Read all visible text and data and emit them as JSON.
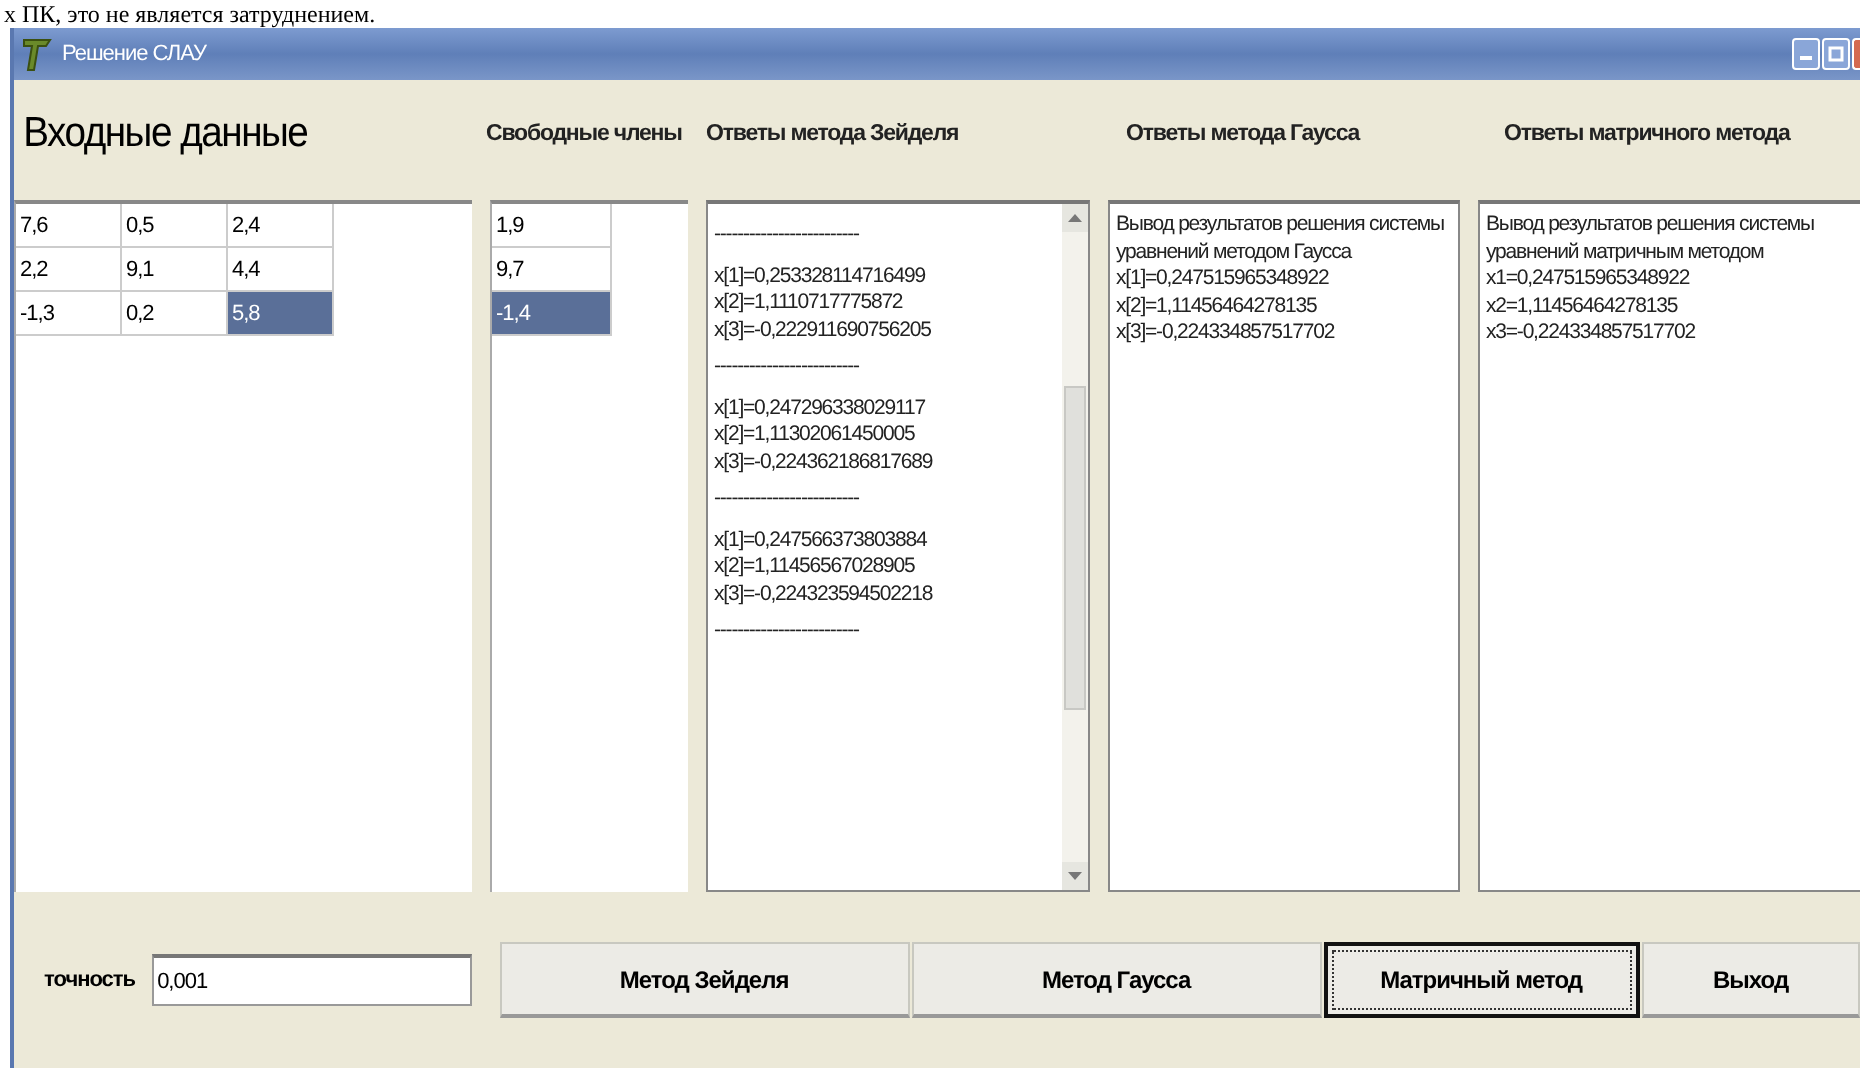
{
  "document_text": "х ПК, это не является затруднением.",
  "window": {
    "title": "Решение СЛАУ"
  },
  "input_heading": "Входные данные",
  "headers": [
    "Свободные члены",
    "Ответы метода Зейделя",
    "Ответы метода Гаусса",
    "Ответы матричного метода"
  ],
  "matrix_grid": {
    "rows": [
      [
        {
          "text": "7,6",
          "selected": false
        },
        {
          "text": "0,5",
          "selected": false
        },
        {
          "text": "2,4",
          "selected": false
        }
      ],
      [
        {
          "text": "2,2",
          "selected": false
        },
        {
          "text": "9,1",
          "selected": false
        },
        {
          "text": "4,4",
          "selected": false
        }
      ],
      [
        {
          "text": "-1,3",
          "selected": false
        },
        {
          "text": "0,2",
          "selected": false
        },
        {
          "text": "5,8",
          "selected": true
        }
      ]
    ]
  },
  "free_terms_grid": {
    "rows": [
      {
        "text": "1,9",
        "selected": false
      },
      {
        "text": "9,7",
        "selected": false
      },
      {
        "text": "-1,4",
        "selected": true
      }
    ]
  },
  "seidel_memo": {
    "lines": [
      {
        "kind": "separator",
        "text": "-------------------------"
      },
      {
        "kind": "value",
        "text": "x[1]=0,253328114716499"
      },
      {
        "kind": "value",
        "text": "x[2]=1,1110717775872"
      },
      {
        "kind": "value",
        "text": "x[3]=-0,222911690756205"
      },
      {
        "kind": "separator",
        "text": "-------------------------"
      },
      {
        "kind": "value",
        "text": "x[1]=0,247296338029117"
      },
      {
        "kind": "value",
        "text": "x[2]=1,11302061450005"
      },
      {
        "kind": "value",
        "text": "x[3]=-0,224362186817689"
      },
      {
        "kind": "separator",
        "text": "-------------------------"
      },
      {
        "kind": "value",
        "text": "x[1]=0,247566373803884"
      },
      {
        "kind": "value",
        "text": "x[2]=1,11456567028905"
      },
      {
        "kind": "value",
        "text": "x[3]=-0,224323594502218"
      },
      {
        "kind": "separator",
        "text": "-------------------------"
      }
    ]
  },
  "gauss_memo": {
    "text": "Вывод результатов решения системы уравнений методом Гаусса",
    "lines": [
      "x[1]=0,247515965348922",
      "x[2]=1,11456464278135",
      "x[3]=-0,224334857517702"
    ]
  },
  "matrix_memo": {
    "text": "Вывод результатов решения системы уравнений матричным методом",
    "lines": [
      "x1=0,247515965348922",
      "x2=1,11456464278135",
      "x3=-0,224334857517702"
    ]
  },
  "precision": {
    "label": "точность",
    "value": "0,001"
  },
  "buttons": [
    {
      "label": "Метод Зейделя",
      "focused": false
    },
    {
      "label": "Метод Гаусса",
      "focused": false
    },
    {
      "label": "Матричный метод",
      "focused": true
    },
    {
      "label": "Выход",
      "focused": false
    }
  ]
}
